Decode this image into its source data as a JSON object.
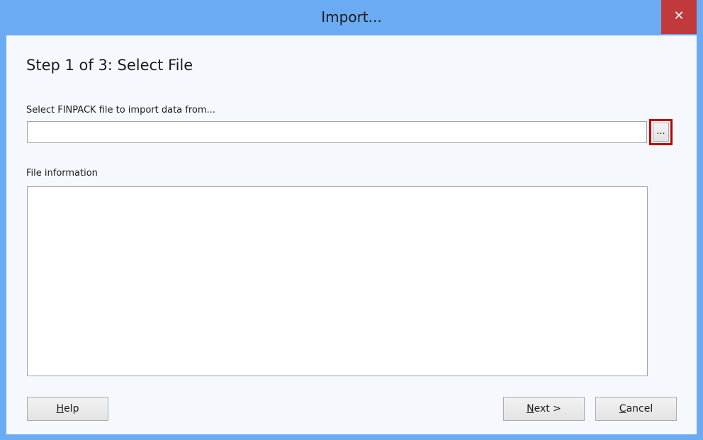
{
  "window": {
    "title": "Import...",
    "close_glyph": "✕"
  },
  "step": {
    "title": "Step 1 of 3: Select File"
  },
  "file_select": {
    "label": "Select FINPACK file to import data from...",
    "value": "",
    "placeholder": "",
    "browse_label": "..."
  },
  "file_info": {
    "label": "File information",
    "content": ""
  },
  "buttons": {
    "help": {
      "mnemonic": "H",
      "rest": "elp"
    },
    "next": {
      "mnemonic": "N",
      "rest": "ext >"
    },
    "cancel": {
      "mnemonic": "C",
      "rest": "ancel"
    }
  },
  "colors": {
    "title_bar": "#6aabf4",
    "close_button": "#c0393b",
    "client_background": "#f5f8fc",
    "highlight_border": "#c00000"
  }
}
